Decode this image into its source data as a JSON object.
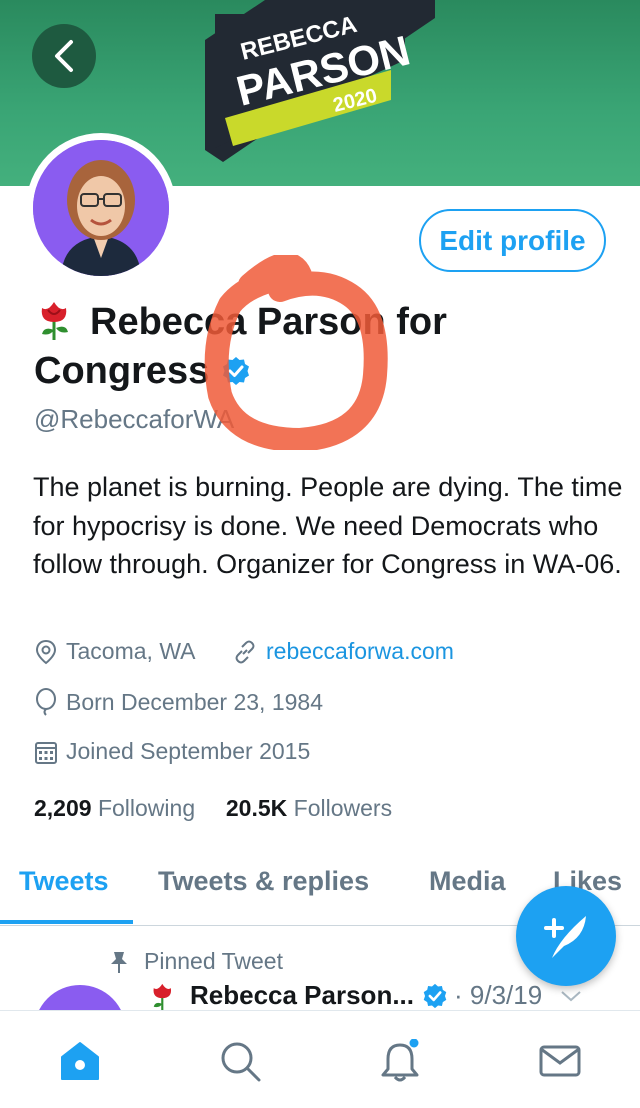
{
  "banner": {
    "logo_line1": "REBECCA",
    "logo_line2": "PARSON",
    "logo_line3": "2020",
    "colors": {
      "green": "#3aa575",
      "dark": "#222933",
      "lime": "#c9d92b"
    }
  },
  "profile": {
    "edit_button": "Edit profile",
    "name_line1": "Rebecca Parson for",
    "name_line2": "Congress",
    "handle": "@RebeccaforWA",
    "bio": "The planet is burning. People are dying. The time for hypocrisy is done. We need Democrats who follow through. Organizer for Congress in WA-06.",
    "location": "Tacoma, WA",
    "website": "rebeccaforwa.com",
    "born": "Born December 23, 1984",
    "joined": "Joined September 2015",
    "following_count": "2,209",
    "following_label": "Following",
    "followers_count": "20.5K",
    "followers_label": "Followers"
  },
  "tabs": [
    {
      "label": "Tweets",
      "active": true
    },
    {
      "label": "Tweets & replies",
      "active": false
    },
    {
      "label": "Media",
      "active": false
    },
    {
      "label": "Likes",
      "active": false
    }
  ],
  "pinned": {
    "label": "Pinned Tweet",
    "author": "Rebecca Parson...",
    "date": "· 9/3/19"
  },
  "icons": [
    "back-arrow-icon",
    "rose-icon",
    "verified-badge-icon",
    "location-pin-icon",
    "link-icon",
    "balloon-icon",
    "calendar-icon",
    "compose-tweet-icon",
    "pin-icon",
    "chevron-down-icon",
    "home-icon",
    "search-icon",
    "notifications-icon",
    "messages-icon"
  ],
  "accent": "#1da1f2"
}
